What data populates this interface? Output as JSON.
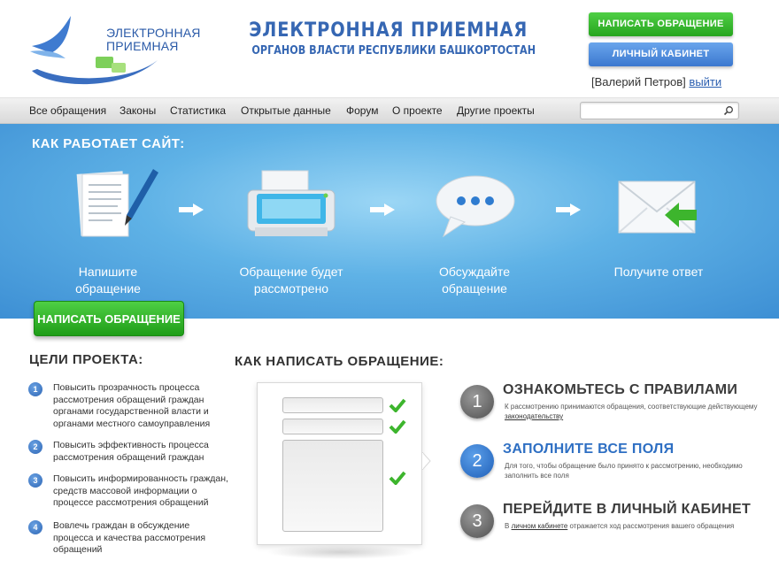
{
  "header": {
    "logo_line1": "ЭЛЕКТРОННАЯ",
    "logo_line2": "ПРИЕМНАЯ",
    "title_line1": "ЭЛЕКТРОННАЯ  ПРИЕМНАЯ",
    "title_line2": "ОРГАНОВ ВЛАСТИ РЕСПУБЛИКИ БАШКОРТОСТАН",
    "write_button": "НАПИСАТЬ ОБРАЩЕНИЕ",
    "cabinet_button": "ЛИЧНЫЙ КАБИНЕТ",
    "user_name": "[Валерий Петров]",
    "logout_link": "выйти"
  },
  "nav": {
    "items": [
      "Все обращения",
      "Законы",
      "Статистика",
      "Открытые данные",
      "Форум",
      "О проекте",
      "Другие проекты"
    ],
    "search_value": ""
  },
  "hero": {
    "title": "КАК РАБОТАЕТ САЙТ:",
    "steps": [
      {
        "label1": "Напишите",
        "label2": "обращение"
      },
      {
        "label1": "Обращение будет",
        "label2": "рассмотрено"
      },
      {
        "label1": "Обсуждайте",
        "label2": "обращение"
      },
      {
        "label1": "Получите ответ",
        "label2": ""
      }
    ],
    "write_button": "НАПИСАТЬ ОБРАЩЕНИЕ"
  },
  "goals": {
    "title": "ЦЕЛИ ПРОЕКТА:",
    "items": [
      {
        "num": "1",
        "text": "Повысить прозрачность процесса рассмотрения обращений граждан органами государственной власти и органами местного самоуправления"
      },
      {
        "num": "2",
        "text": "Повысить эффективность процесса рассмотрения обращений граждан"
      },
      {
        "num": "3",
        "text": "Повысить информированность граждан, средств массовой информации о процессе рассмотрения обращений"
      },
      {
        "num": "4",
        "text": "Вовлечь граждан в обсуждение процесса и качества рассмотрения обращений"
      }
    ]
  },
  "how": {
    "title": "КАК НАПИСАТЬ ОБРАЩЕНИЕ:",
    "steps": [
      {
        "num": "1",
        "heading": "ОЗНАКОМЬТЕСЬ С ПРАВИЛАМИ",
        "desc": "К рассмотрению принимаются обращения, соответствующие действующему",
        "link": "законодательству",
        "desc_after": ""
      },
      {
        "num": "2",
        "heading": "ЗАПОЛНИТЕ ВСЕ ПОЛЯ",
        "desc": "Для того, чтобы обращение было принято к рассмотрению, необходимо заполнить все поля",
        "link": "",
        "desc_after": ""
      },
      {
        "num": "3",
        "heading": "ПЕРЕЙДИТЕ В ЛИЧНЫЙ КАБИНЕТ",
        "desc": "В",
        "link": "личном кабинете",
        "desc_after": "отражается ход рассмотрения вашего обращения"
      }
    ]
  },
  "colors": {
    "brand_blue": "#3667b3",
    "green_button": "#27a51f",
    "blue_button": "#3b78cf",
    "hero_bg": "#5fb2e6"
  }
}
